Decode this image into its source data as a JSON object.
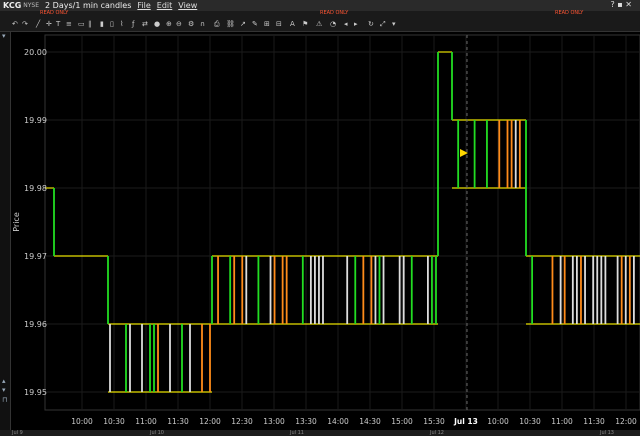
{
  "menubar": {
    "symbol": "KCG",
    "exchange": "NYSE",
    "timeframe": "2 Days/1 min candles",
    "menus": [
      "File",
      "Edit",
      "View"
    ],
    "window_controls": "? ▪ ✕"
  },
  "toolbar": {
    "read_only_labels": [
      "READ ONLY",
      "READ ONLY",
      "READ ONLY"
    ]
  },
  "chart_data": {
    "type": "candlestick",
    "title": "",
    "xlabel": "",
    "ylabel": "Price",
    "ylim": [
      19.95,
      20.0
    ],
    "y_ticks": [
      "20.00",
      "19.99",
      "19.98",
      "19.97",
      "19.96",
      "19.95"
    ],
    "x_ticks": [
      "10:00",
      "10:30",
      "11:00",
      "11:30",
      "12:00",
      "12:30",
      "13:00",
      "13:30",
      "14:00",
      "14:30",
      "15:00",
      "15:30",
      "Jul 13",
      "10:00",
      "10:30",
      "11:00",
      "11:30",
      "12:00"
    ],
    "session_break": "Jul 13",
    "grid": true,
    "colors": {
      "up": "#22dd22",
      "down": "#ff8c1a",
      "flat": "#dddddd",
      "outline": "#e8e000",
      "cursor": "#ffd700"
    },
    "segments": [
      {
        "from": "09:30",
        "to": "09:45",
        "level": 19.98
      },
      {
        "from": "09:45",
        "to": "10:40",
        "level": 19.97
      },
      {
        "from": "10:40",
        "to": "12:05",
        "level": 19.96,
        "low": 19.95
      },
      {
        "from": "12:05",
        "to": "15:30",
        "level": 19.97,
        "low": 19.96
      },
      {
        "from": "15:30",
        "to": "15:40",
        "level": 20.0
      },
      {
        "from": "15:40",
        "to": "Jul 13 09:45",
        "level": 19.99,
        "low": 19.98
      },
      {
        "from": "Jul 13 09:45",
        "to": "Jul 13 11:45",
        "level": 19.97,
        "low": 19.96
      }
    ]
  },
  "statusbar": {
    "labels": [
      "Jul 9",
      "Jul 10",
      "Jul 11",
      "Jul 12",
      "Jul 13"
    ]
  }
}
